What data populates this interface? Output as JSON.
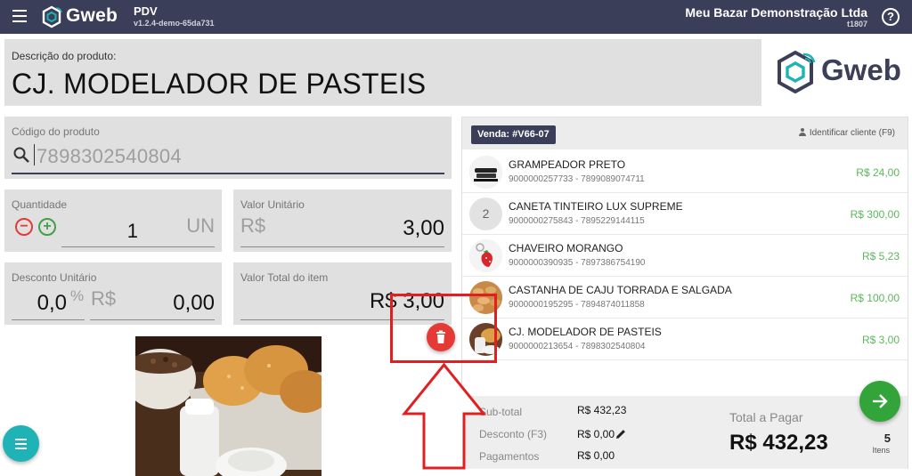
{
  "header": {
    "brand": "Gweb",
    "app_name": "PDV",
    "version": "v1.2.4-demo-65da731",
    "store_name": "Meu Bazar Demonstração Ltda",
    "store_code": "t1807",
    "help_label": "?"
  },
  "description": {
    "label": "Descrição do produto:",
    "value": "CJ. MODELADOR DE PASTEIS",
    "logo_text": "Gweb"
  },
  "product_code": {
    "label": "Código do produto",
    "value": "7898302540804"
  },
  "quantity": {
    "label": "Quantidade",
    "minus": "−",
    "plus": "+",
    "value": "1",
    "unit": "UN"
  },
  "unit_price": {
    "label": "Valor Unitário",
    "currency": "R$",
    "value": "3,00"
  },
  "unit_discount": {
    "label": "Desconto Unitário",
    "percent_value": "0,0",
    "percent_symbol": "%",
    "currency": "R$",
    "value": "0,00"
  },
  "item_total": {
    "label": "Valor Total do item",
    "value": "R$ 3,00"
  },
  "sale": {
    "badge": "Venda: #V66-07",
    "identify_client": "Identificar cliente (F9)",
    "items": [
      {
        "thumb": "",
        "name": "GRAMPEADOR PRETO",
        "codes": "9000000257733 - 7899089074711",
        "price": "R$ 24,00"
      },
      {
        "thumb": "2",
        "name": "CANETA TINTEIRO LUX SUPREME",
        "codes": "9000000275843 - 7895229144115",
        "price": "R$ 300,00"
      },
      {
        "thumb": "",
        "name": "CHAVEIRO MORANGO",
        "codes": "9000000390935 - 7897386754190",
        "price": "R$ 5,23"
      },
      {
        "thumb": "",
        "name": "CASTANHA DE CAJU TORRADA E SALGADA",
        "codes": "9000000195295 - 7894874011858",
        "price": "R$ 100,00"
      },
      {
        "thumb": "",
        "name": "CJ. MODELADOR DE PASTEIS",
        "codes": "9000000213654 - 7898302540804",
        "price": "R$ 3,00"
      }
    ],
    "subtotal_label": "Sub-total",
    "subtotal_value": "R$ 432,23",
    "discount_label": "Desconto (F3)",
    "discount_value": "R$ 0,00",
    "payments_label": "Pagamentos",
    "payments_value": "R$ 0,00",
    "to_pay_label": "Total a Pagar",
    "to_pay_value": "R$ 432,23",
    "items_count": "5",
    "items_label": "Itens"
  },
  "colors": {
    "topbar": "#3a3e58",
    "field_bg": "#e0e0e0",
    "price_green": "#5cb85c",
    "delete_red": "#e53935",
    "menu_teal": "#1fb3b6",
    "next_green": "#33a43a",
    "highlight_red": "#e02020"
  }
}
